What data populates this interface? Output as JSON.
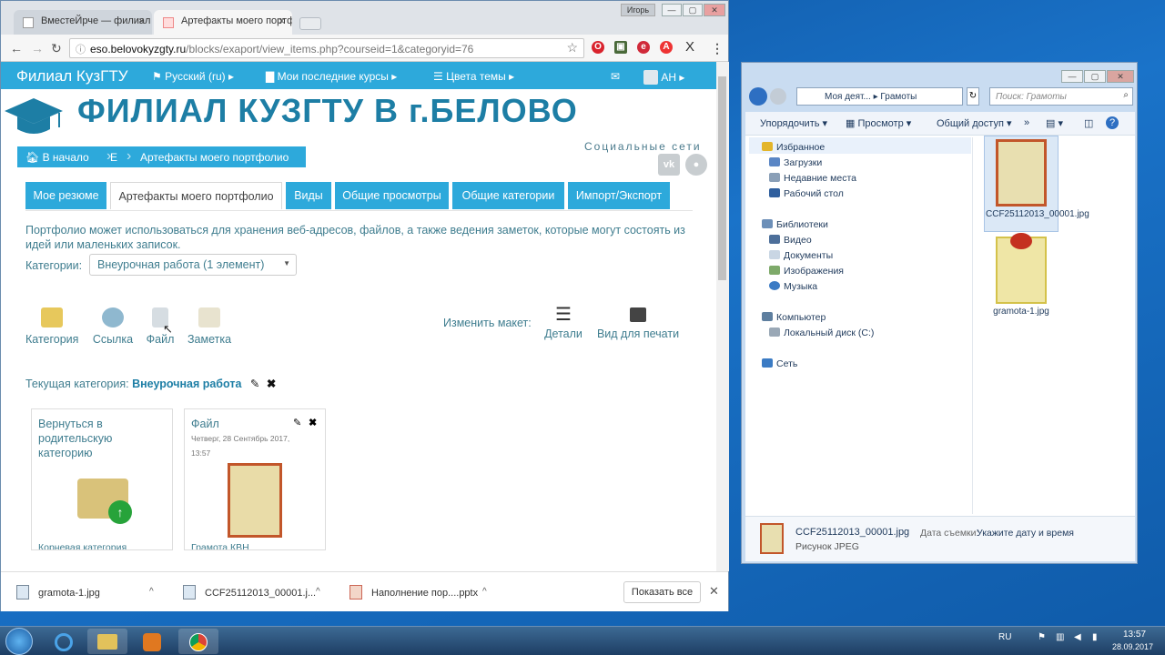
{
  "chrome": {
    "tabs": [
      {
        "label": "ВместеЙрче — филиал К",
        "active": false
      },
      {
        "label": "Артефакты моего портф",
        "active": true
      }
    ],
    "user_badge": "Игорь",
    "url_domain": "eso.belovokyzgty.ru",
    "url_path": "/blocks/exaport/view_items.php?courseid=1&categoryid=76"
  },
  "site": {
    "brand": "Филиал КузГТУ",
    "nav": [
      {
        "label": "Русский (ru)",
        "icon": "flag-icon"
      },
      {
        "label": "Мои последние курсы",
        "icon": "briefcase-icon"
      },
      {
        "label": "Цвета темы",
        "icon": "list-icon"
      }
    ],
    "user_initials": "АН",
    "banner_title": "ФИЛИАЛ КУЗГТУ В г.БЕЛОВО",
    "breadcrumbs": [
      "В начало",
      "Е",
      "Артефакты моего портфолио"
    ],
    "social_label": "Социальные сети",
    "portfolio_tabs": [
      "Мое резюме",
      "Артефакты моего портфолио",
      "Виды",
      "Общие просмотры",
      "Общие категории",
      "Импорт/Экспорт"
    ],
    "description": "Портфолио может использоваться для хранения веб-адресов, файлов, а также ведения заметок, которые могут состоять из идей или маленьких записок.",
    "category_label": "Категории:",
    "category_value": "Внеурочная работа (1 элемент)",
    "actions": [
      "Категория",
      "Ссылка",
      "Файл",
      "Заметка"
    ],
    "layout_label": "Изменить макет:",
    "layout_actions": [
      "Детали",
      "Вид для печати"
    ],
    "current_category_label": "Текущая категория:",
    "current_category_value": "Внеурочная работа",
    "cards": {
      "parent": {
        "title": "Вернуться в родительскую категорию",
        "footer": "Корневая категория"
      },
      "file": {
        "title": "Файл",
        "date": "Четверг, 28 Сентябрь 2017,",
        "time": "13:57",
        "footer": "Грамота  КВН"
      }
    }
  },
  "downloads": {
    "items": [
      "gramota-1.jpg",
      "CCF25112013_00001.j...",
      "Наполнение пор....pptx"
    ],
    "show_all": "Показать все"
  },
  "explorer": {
    "path": [
      "Моя деят...",
      "Грамоты"
    ],
    "search_placeholder": "Поиск: Грамоты",
    "toolbar": [
      "Упорядочить",
      "Просмотр",
      "Общий доступ"
    ],
    "tree": {
      "favorites": "Избранное",
      "favorites_items": [
        "Загрузки",
        "Недавние места",
        "Рабочий стол"
      ],
      "libraries": "Библиотеки",
      "libraries_items": [
        "Видео",
        "Документы",
        "Изображения",
        "Музыка"
      ],
      "computer": "Компьютер",
      "computer_items": [
        "Локальный диск (C:)"
      ],
      "network": "Сеть"
    },
    "files": [
      "CCF25112013_00001.jpg",
      "gramota-1.jpg"
    ],
    "details": {
      "name": "CCF25112013_00001.jpg",
      "type": "Рисунок JPEG",
      "date_label": "Дата съемки:",
      "date_value": "Укажите дату и время"
    }
  },
  "taskbar": {
    "lang": "RU",
    "time": "13:57",
    "date": "28.09.2017"
  }
}
